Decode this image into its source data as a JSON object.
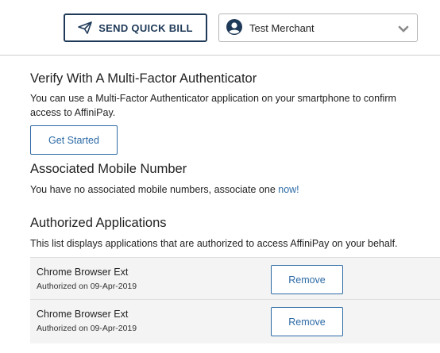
{
  "header": {
    "quick_bill_label": "SEND QUICK BILL",
    "merchant_name": "Test Merchant",
    "brand_color": "#1f3a58"
  },
  "mfa": {
    "title": "Verify With A Multi-Factor Authenticator",
    "description": "You can use a Multi-Factor Authenticator application on your smartphone to confirm access to AffiniPay.",
    "button_label": "Get Started"
  },
  "mobile": {
    "title": "Associated Mobile Number",
    "description": "You have no associated mobile numbers, associate one ",
    "link_label": "now!"
  },
  "apps": {
    "title": "Authorized Applications",
    "description": "This list displays applications that are authorized to access AffiniPay on your behalf.",
    "items": [
      {
        "name": "Chrome Browser Ext",
        "authorized": "Authorized on 09-Apr-2019",
        "button_label": "Remove"
      },
      {
        "name": "Chrome Browser Ext",
        "authorized": "Authorized on 09-Apr-2019",
        "button_label": "Remove"
      }
    ]
  },
  "accent_color": "#2c6aa5"
}
